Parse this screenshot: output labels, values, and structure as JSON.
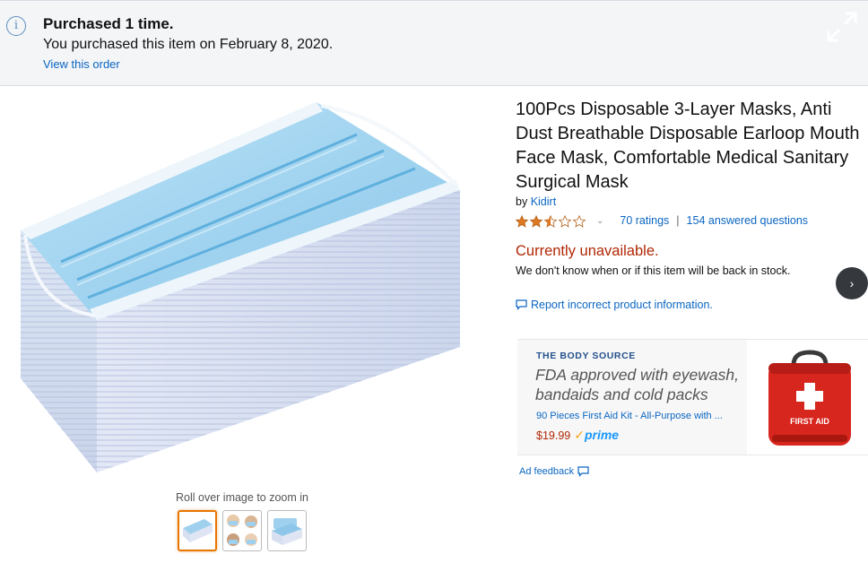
{
  "banner": {
    "title": "Purchased 1 time.",
    "text": "You purchased this item on February 8, 2020.",
    "link": "View this order"
  },
  "gallery": {
    "zoom_hint": "Roll over image to zoom in",
    "thumbnails": [
      "mask-stack-thumbnail",
      "mask-people-thumbnail",
      "mask-box-thumbnail"
    ]
  },
  "product": {
    "title": "100Pcs Disposable 3-Layer Masks, Anti Dust Breathable Disposable Earloop Mouth Face Mask, Comfortable Medical Sanitary Surgical Mask",
    "by_prefix": "by ",
    "brand": "Kidirt",
    "rating_stars": 2.5,
    "ratings": "70 ratings",
    "separator": "|",
    "questions": "154 answered questions",
    "availability": "Currently unavailable.",
    "stock_note": "We don't know when or if this item will be back in stock.",
    "report_link": "Report incorrect product information."
  },
  "ad": {
    "brand": "THE BODY SOURCE",
    "headline": "FDA approved with eyewash, bandaids and cold packs",
    "product": "90 Pieces First Aid Kit - All-Purpose with ...",
    "price": "$19.99",
    "prime_check": "✓",
    "prime": "prime",
    "image_label": "FIRST AID",
    "feedback": "Ad feedback"
  },
  "icons": {
    "info": "info-icon",
    "expand": "expand-icon",
    "next": "chevron-right-icon",
    "report": "speech-bubble-icon",
    "feedback": "speech-bubble-icon"
  },
  "colors": {
    "link": "#0b66c2",
    "unavailable": "#b12704",
    "star": "#de7921",
    "prime": "#1a98ff",
    "first_aid_red": "#d7261e",
    "mask_blue": "#9fd0ee"
  }
}
